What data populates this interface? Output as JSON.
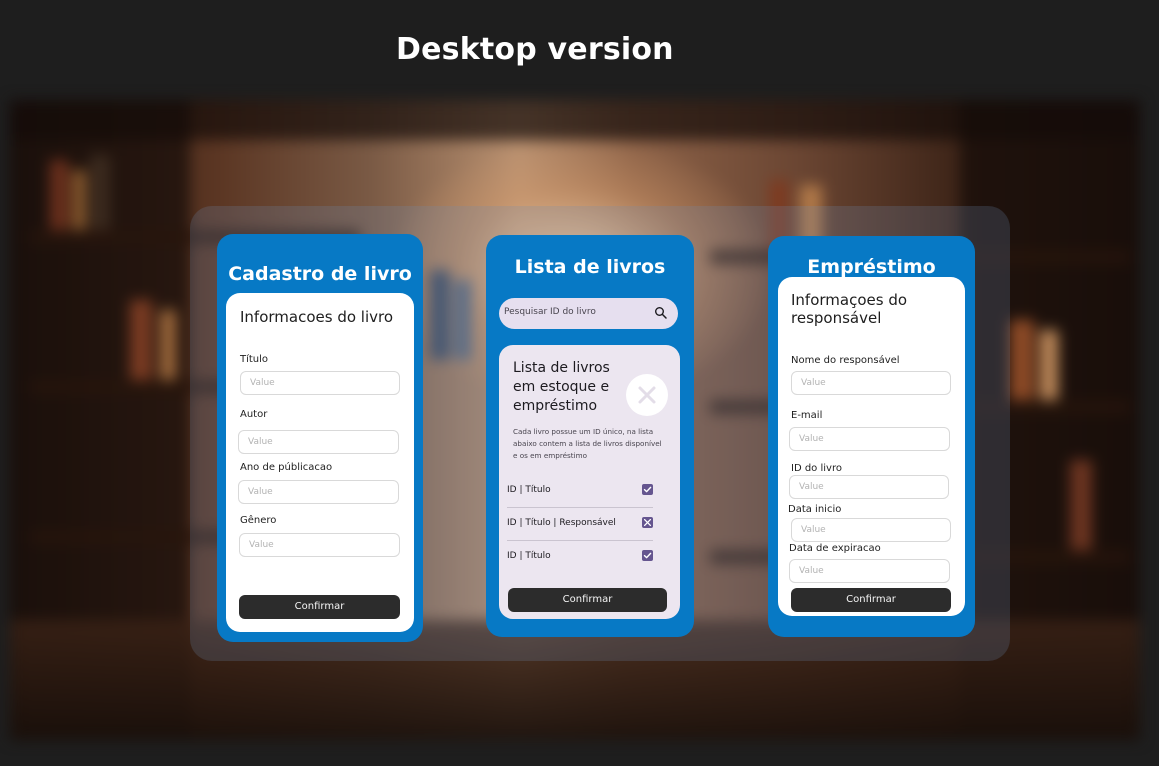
{
  "page": {
    "title": "Desktop version"
  },
  "cadastro": {
    "title": "Cadastro de livro",
    "section_title": "Informacoes do livro",
    "fields": [
      {
        "label": "Título",
        "placeholder": "Value"
      },
      {
        "label": "Autor",
        "placeholder": "Value"
      },
      {
        "label": "Ano de públicacao",
        "placeholder": "Value"
      },
      {
        "label": "Gênero",
        "placeholder": "Value"
      }
    ],
    "confirm_label": "Confirmar"
  },
  "lista": {
    "title": "Lista de livros",
    "search_placeholder": "Pesquisar ID do livro",
    "search_icon": "search-icon",
    "panel_title": "Lista de livros em estoque e empréstimo",
    "close_icon": "close-icon",
    "description": "Cada livro possue um ID único, na lista abaixo contem a lista de livros disponível e os em empréstimo",
    "rows": [
      {
        "text": "ID | Título",
        "state": "checked"
      },
      {
        "text": "ID | Título | Responsável",
        "state": "crossed"
      },
      {
        "text": "ID | Título",
        "state": "checked"
      }
    ],
    "confirm_label": "Confirmar"
  },
  "emprestimo": {
    "title": "Empréstimo",
    "section_title": "Informaçoes do responsável",
    "fields": [
      {
        "label": "Nome do responsável",
        "placeholder": "Value"
      },
      {
        "label": "E-mail",
        "placeholder": "Value"
      },
      {
        "label": "ID do livro",
        "placeholder": "Value"
      },
      {
        "label": "Data inicio",
        "placeholder": "Value"
      },
      {
        "label": "Data de expiracao",
        "placeholder": "Value"
      }
    ],
    "confirm_label": "Confirmar"
  },
  "colors": {
    "card_blue": "#0779c5",
    "button_dark": "#2c2c2c",
    "checkbox_purple": "#65558f",
    "panel_lavender": "#ece6f0"
  }
}
